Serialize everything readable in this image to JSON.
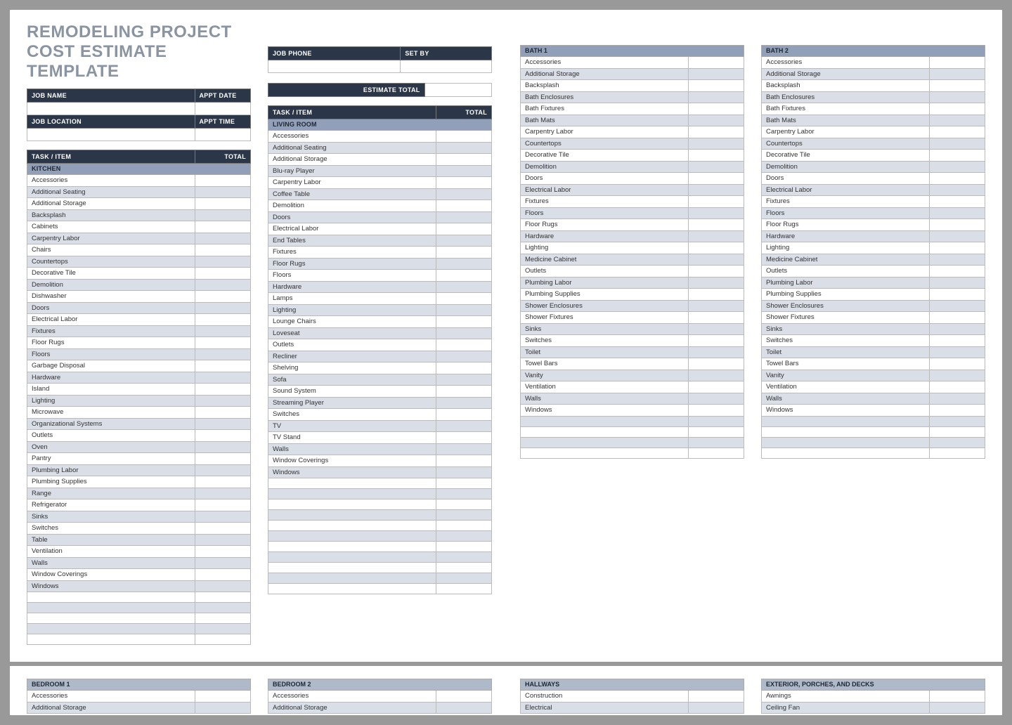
{
  "title": "REMODELING PROJECT COST ESTIMATE TEMPLATE",
  "info_left": {
    "job_name_h": "JOB NAME",
    "appt_date_h": "APPT DATE",
    "job_location_h": "JOB LOCATION",
    "appt_time_h": "APPT TIME"
  },
  "info_right": {
    "job_phone_h": "JOB PHONE",
    "set_by_h": "SET BY"
  },
  "estimate_total_h": "ESTIMATE TOTAL",
  "task_h": "TASK / ITEM",
  "total_h": "TOTAL",
  "sections": {
    "kitchen": {
      "name": "KITCHEN",
      "items": [
        "Accessories",
        "Additional Seating",
        "Additional Storage",
        "Backsplash",
        "Cabinets",
        "Carpentry Labor",
        "Chairs",
        "Countertops",
        "Decorative Tile",
        "Demolition",
        "Dishwasher",
        "Doors",
        "Electrical Labor",
        "Fixtures",
        "Floor Rugs",
        "Floors",
        "Garbage Disposal",
        "Hardware",
        "Island",
        "Lighting",
        "Microwave",
        "Organizational Systems",
        "Outlets",
        "Oven",
        "Pantry",
        "Plumbing Labor",
        "Plumbing Supplies",
        "Range",
        "Refrigerator",
        "Sinks",
        "Switches",
        "Table",
        "Ventilation",
        "Walls",
        "Window Coverings",
        "Windows"
      ],
      "blanks": 5
    },
    "living": {
      "name": "LIVING ROOM",
      "items": [
        "Accessories",
        "Additional Seating",
        "Additional Storage",
        "Blu-ray Player",
        "Carpentry Labor",
        "Coffee Table",
        "Demolition",
        "Doors",
        "Electrical Labor",
        "End Tables",
        "Fixtures",
        "Floor Rugs",
        "Floors",
        "Hardware",
        "Lamps",
        "Lighting",
        "Lounge Chairs",
        "Loveseat",
        "Outlets",
        "Recliner",
        "Shelving",
        "Sofa",
        "Sound System",
        "Streaming Player",
        "Switches",
        "TV",
        "TV Stand",
        "Walls",
        "Window Coverings",
        "Windows"
      ],
      "blanks": 11
    },
    "bath1": {
      "name": "BATH 1",
      "items": [
        "Accessories",
        "Additional Storage",
        "Backsplash",
        "Bath Enclosures",
        "Bath Fixtures",
        "Bath Mats",
        "Carpentry Labor",
        "Countertops",
        "Decorative Tile",
        "Demolition",
        "Doors",
        "Electrical Labor",
        "Fixtures",
        "Floors",
        "Floor Rugs",
        "Hardware",
        "Lighting",
        "Medicine Cabinet",
        "Outlets",
        "Plumbing Labor",
        "Plumbing Supplies",
        "Shower Enclosures",
        "Shower Fixtures",
        "Sinks",
        "Switches",
        "Toilet",
        "Towel Bars",
        "Vanity",
        "Ventilation",
        "Walls",
        "Windows"
      ],
      "blanks": 4
    },
    "bath2": {
      "name": "BATH 2",
      "items": [
        "Accessories",
        "Additional Storage",
        "Backsplash",
        "Bath Enclosures",
        "Bath Fixtures",
        "Bath Mats",
        "Carpentry Labor",
        "Countertops",
        "Decorative Tile",
        "Demolition",
        "Doors",
        "Electrical Labor",
        "Fixtures",
        "Floors",
        "Floor Rugs",
        "Hardware",
        "Lighting",
        "Medicine Cabinet",
        "Outlets",
        "Plumbing Labor",
        "Plumbing Supplies",
        "Shower Enclosures",
        "Shower Fixtures",
        "Sinks",
        "Switches",
        "Toilet",
        "Towel Bars",
        "Vanity",
        "Ventilation",
        "Walls",
        "Windows"
      ],
      "blanks": 4
    },
    "bedroom1": {
      "name": "BEDROOM 1",
      "items": [
        "Accessories",
        "Additional Storage"
      ]
    },
    "bedroom2": {
      "name": "BEDROOM 2",
      "items": [
        "Accessories",
        "Additional Storage"
      ]
    },
    "hallways": {
      "name": "HALLWAYS",
      "items": [
        "Construction",
        "Electrical"
      ]
    },
    "exterior": {
      "name": "EXTERIOR, PORCHES, AND DECKS",
      "items": [
        "Awnings",
        "Ceiling Fan"
      ]
    }
  }
}
